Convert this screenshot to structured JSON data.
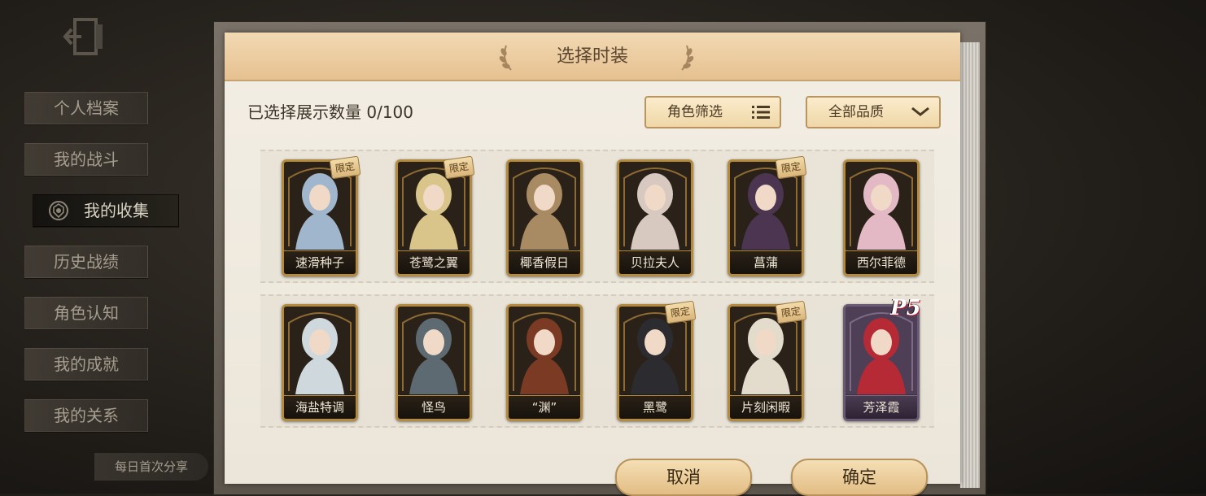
{
  "sidebar": {
    "items": [
      {
        "label": "个人档案"
      },
      {
        "label": "我的战斗"
      },
      {
        "label": "我的收集"
      },
      {
        "label": "历史战绩"
      },
      {
        "label": "角色认知"
      },
      {
        "label": "我的成就"
      },
      {
        "label": "我的关系"
      }
    ],
    "active_index": 2,
    "share_label": "每日首次分享",
    "exit_icon": "exit-door-icon"
  },
  "dialog": {
    "title": "选择时装",
    "selected_count_label": "已选择展示数量",
    "selected_count": "0/100",
    "role_filter_label": "角色筛选",
    "role_filter_icon": "list-icon",
    "quality_filter_label": "全部品质",
    "quality_filter_icon": "chevron-down-icon",
    "limited_label": "限定",
    "costumes": [
      {
        "name": "速滑种子",
        "limited": true,
        "tint": "#9fb6cc"
      },
      {
        "name": "苍鹭之翼",
        "limited": true,
        "tint": "#d9c48a"
      },
      {
        "name": "椰香假日",
        "limited": false,
        "tint": "#a98b63"
      },
      {
        "name": "贝拉夫人",
        "limited": false,
        "tint": "#d8c9c0"
      },
      {
        "name": "菖蒲",
        "limited": true,
        "tint": "#4b3550"
      },
      {
        "name": "西尔菲德",
        "limited": false,
        "tint": "#e2b9c4"
      },
      {
        "name": "海盐特调",
        "limited": false,
        "tint": "#cfd8dd"
      },
      {
        "name": "怪鸟",
        "limited": false,
        "tint": "#5d6a72"
      },
      {
        "name": "“渊”",
        "limited": false,
        "tint": "#7b3a24"
      },
      {
        "name": "黑鹭",
        "limited": true,
        "tint": "#2c2c30"
      },
      {
        "name": "片刻闲暇",
        "limited": true,
        "tint": "#e3dccd"
      },
      {
        "name": "芳泽霞",
        "limited": false,
        "tint": "#b52a35",
        "badge": "P5"
      }
    ],
    "cancel_label": "取消",
    "confirm_label": "确定"
  }
}
